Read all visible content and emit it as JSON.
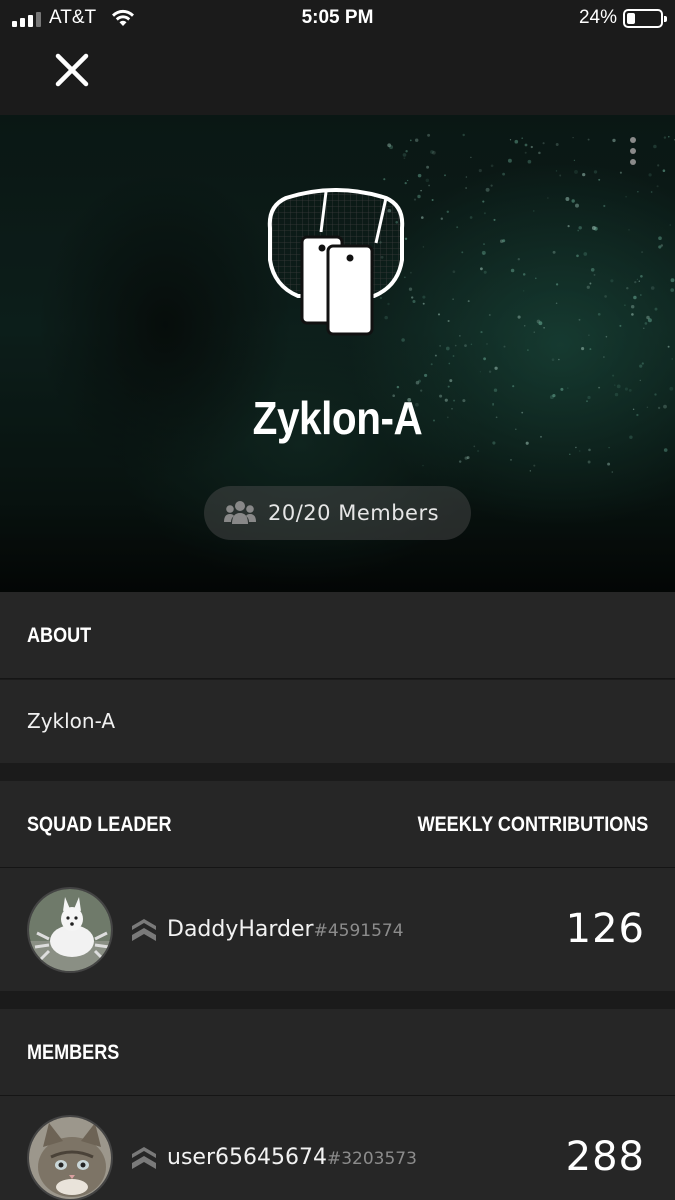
{
  "status_bar": {
    "carrier": "AT&T",
    "time": "5:05 PM",
    "battery_percent": "24%",
    "battery_level": 0.24,
    "signal_bars_active": 3,
    "signal_bars_total": 4
  },
  "nav": {
    "close_icon": "close-icon",
    "more_icon": "more-vertical-icon"
  },
  "squad": {
    "name": "Zyklon-A",
    "emblem_icon": "dog-tags-emblem-icon",
    "members_icon": "group-icon",
    "members_label": "20/20 Members"
  },
  "about": {
    "header": "ABOUT",
    "text": "Zyklon-A"
  },
  "leader_section": {
    "header": "SQUAD LEADER",
    "right_header": "WEEKLY CONTRIBUTIONS",
    "leader": {
      "username": "DaddyHarder",
      "tag": "#4591574",
      "contributions": "126",
      "rank_icon": "rank-chevron-icon"
    }
  },
  "members_section": {
    "header": "MEMBERS",
    "members": [
      {
        "username": "user65645674",
        "tag": "#3203573",
        "contributions": "288",
        "rank_icon": "rank-chevron-icon"
      }
    ]
  },
  "colors": {
    "background": "#1b1b1b",
    "panel": "#262626",
    "hero_accent": "#1f5a4a",
    "muted_text": "#8c8c8c"
  }
}
